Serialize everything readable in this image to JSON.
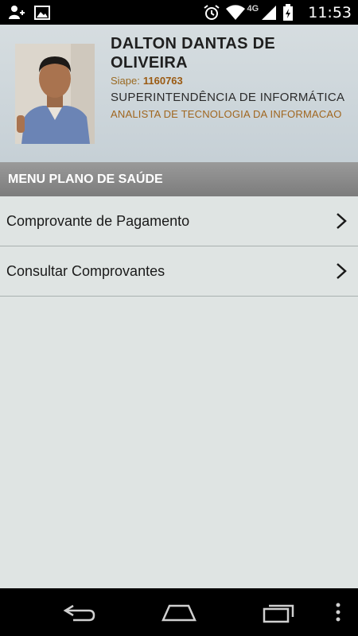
{
  "status_bar": {
    "time": "11:53",
    "network_label": "4G",
    "icons": [
      "add-contact-icon",
      "image-icon",
      "alarm-icon",
      "wifi-icon",
      "signal-icon",
      "battery-icon"
    ]
  },
  "profile": {
    "name": "DALTON DANTAS DE OLIVEIRA",
    "siape_label": "Siape:",
    "siape_number": "1160763",
    "department": "SUPERINTENDÊNCIA DE INFORMÁTICA",
    "role": "ANALISTA DE TECNOLOGIA DA INFORMACAO"
  },
  "menu": {
    "header": "MENU PLANO DE SAÚDE",
    "items": [
      {
        "label": "Comprovante de Pagamento",
        "icon": "chevron-right-icon"
      },
      {
        "label": "Consultar Comprovantes",
        "icon": "chevron-right-icon"
      }
    ]
  },
  "nav_bar": {
    "buttons": [
      "back-icon",
      "home-icon",
      "recent-apps-icon",
      "overflow-menu-icon"
    ]
  },
  "colors": {
    "accent_orange": "#a0661f",
    "header_gray": "#8a8a8a",
    "background": "#dfe4e3"
  }
}
